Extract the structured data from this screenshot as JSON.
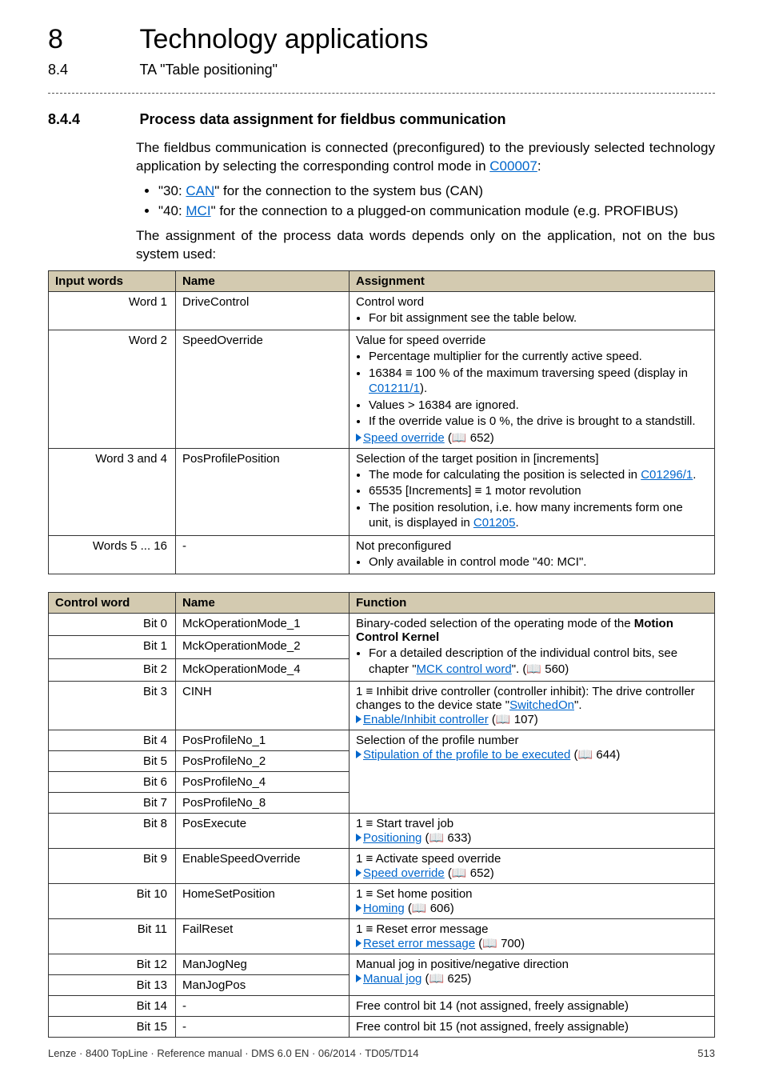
{
  "chapter": {
    "num": "8",
    "title": "Technology applications"
  },
  "section": {
    "num": "8.4",
    "title": "TA \"Table positioning\""
  },
  "heading": {
    "num": "8.4.4",
    "title": "Process data assignment for fieldbus communication"
  },
  "intro1a": "The fieldbus communication is connected (preconfigured) to the previously selected technology application by selecting the corresponding control mode in ",
  "intro1_link": "C00007",
  "intro1b": ":",
  "bullet1a": "\"30: ",
  "bullet1_link": "CAN",
  "bullet1b": "\" for the connection to the system bus (CAN)",
  "bullet2a": "\"40: ",
  "bullet2_link": "MCI",
  "bullet2b": "\" for the connection to a plugged-on communication module (e.g. PROFIBUS)",
  "intro2": "The assignment of the process data words depends only on the application, not on the bus system used:",
  "t1": {
    "h1": "Input words",
    "h2": "Name",
    "h3": "Assignment",
    "r1": {
      "c1": "Word 1",
      "c2": "DriveControl",
      "c3_line": "Control word",
      "c3_li1": "For bit assignment see the table below."
    },
    "r2": {
      "c1": "Word 2",
      "c2": "SpeedOverride",
      "c3_line": "Value for speed override",
      "c3_li1": "Percentage multiplier for the currently active speed.",
      "c3_li2a": "16384 ≡ 100 % of the maximum traversing speed (display in ",
      "c3_li2_link": "C01211/1",
      "c3_li2b": ").",
      "c3_li3": "Values > 16384 are ignored.",
      "c3_li4": "If the override value is 0 %, the drive is brought to a standstill.",
      "c3_link": "Speed override",
      "c3_pg": " (📖 652)"
    },
    "r3": {
      "c1": "Word 3 and 4",
      "c2": "PosProfilePosition",
      "c3_line": "Selection of the target position in [increments]",
      "c3_li1a": "The mode for calculating the position is selected in ",
      "c3_li1_link": "C01296/1",
      "c3_li1b": ".",
      "c3_li2": "65535 [Increments] ≡ 1 motor revolution",
      "c3_li3a": "The position resolution, i.e. how many increments form one unit, is displayed in ",
      "c3_li3_link": "C01205",
      "c3_li3b": "."
    },
    "r4": {
      "c1": "Words 5 ... 16",
      "c2": "-",
      "c3_line": "Not preconfigured",
      "c3_li1": "Only available in control mode \"40: MCI\"."
    }
  },
  "t2": {
    "h1": "Control word",
    "h2": "Name",
    "h3": "Function",
    "grp1_line1a": "Binary-coded selection of the operating mode of the ",
    "grp1_line1b": "Motion Control Kernel",
    "grp1_li1a": "For a detailed description of the individual control bits, see chapter \"",
    "grp1_li1_link": "MCK control word",
    "grp1_li1b": "\". (📖 560)",
    "r0": {
      "c1": "Bit 0",
      "c2": "MckOperationMode_1"
    },
    "r1": {
      "c1": "Bit 1",
      "c2": "MckOperationMode_2"
    },
    "r2": {
      "c1": "Bit 2",
      "c2": "MckOperationMode_4"
    },
    "r3": {
      "c1": "Bit 3",
      "c2": "CINH",
      "c3_line1": "1 ≡ Inhibit drive controller (controller inhibit): The drive controller changes to the device state \"",
      "c3_link1": "SwitchedOn",
      "c3_line1b": "\".",
      "c3_link2": "Enable/Inhibit controller",
      "c3_pg": "  (📖 107)"
    },
    "grp2_line": "Selection of the profile number",
    "grp2_link": "Stipulation of the profile to be executed",
    "grp2_pg": " (📖 644)",
    "r4": {
      "c1": "Bit 4",
      "c2": "PosProfileNo_1"
    },
    "r5": {
      "c1": "Bit 5",
      "c2": "PosProfileNo_2"
    },
    "r6": {
      "c1": "Bit 6",
      "c2": "PosProfileNo_4"
    },
    "r7": {
      "c1": "Bit 7",
      "c2": "PosProfileNo_8"
    },
    "r8": {
      "c1": "Bit 8",
      "c2": "PosExecute",
      "c3_line": "1 ≡ Start travel job",
      "c3_link": "Positioning",
      "c3_pg": " (📖 633)"
    },
    "r9": {
      "c1": "Bit 9",
      "c2": "EnableSpeedOverride",
      "c3_line": "1 ≡ Activate speed override",
      "c3_link": "Speed override",
      "c3_pg": " (📖 652)"
    },
    "r10": {
      "c1": "Bit 10",
      "c2": "HomeSetPosition",
      "c3_line": "1 ≡ Set home position",
      "c3_link": "Homing",
      "c3_pg": " (📖 606)"
    },
    "r11": {
      "c1": "Bit 11",
      "c2": "FailReset",
      "c3_line": "1 ≡ Reset error message",
      "c3_link": "Reset error message",
      "c3_pg": "  (📖 700)"
    },
    "grp3_line": "Manual jog in positive/negative direction",
    "grp3_link": "Manual jog",
    "grp3_pg": " (📖 625)",
    "r12": {
      "c1": "Bit 12",
      "c2": "ManJogNeg"
    },
    "r13": {
      "c1": "Bit 13",
      "c2": "ManJogPos"
    },
    "r14": {
      "c1": "Bit 14",
      "c2": "-",
      "c3": "Free control bit 14 (not assigned, freely assignable)"
    },
    "r15": {
      "c1": "Bit 15",
      "c2": "-",
      "c3": "Free control bit 15 (not assigned, freely assignable)"
    }
  },
  "footer_left": "Lenze · 8400 TopLine · Reference manual · DMS 6.0 EN · 06/2014 · TD05/TD14",
  "footer_right": "513"
}
